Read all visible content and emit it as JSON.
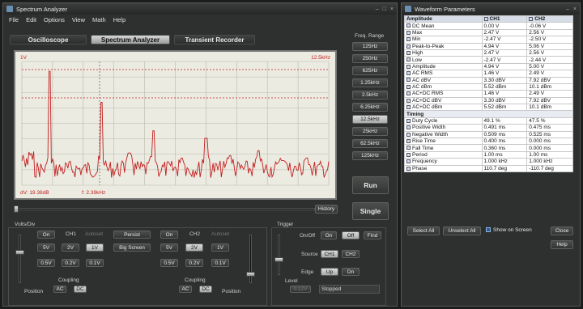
{
  "spectrum": {
    "title": "Spectrum Analyzer",
    "menu": [
      "File",
      "Edit",
      "Options",
      "View",
      "Math",
      "Help"
    ],
    "modes": [
      "Oscilloscope",
      "Spectrum Analyzer",
      "Transient Recorder"
    ],
    "active_mode": "Spectrum Analyzer",
    "freq_range_label": "Freq. Range",
    "freq_ranges": [
      "125Hz",
      "250Hz",
      "625Hz",
      "1.25kHz",
      "2.5kHz",
      "6.25kHz",
      "12.5kHz",
      "25kHz",
      "62.5kHz",
      "125kHz"
    ],
    "selected_freq_range": "12.5kHz",
    "plot": {
      "top_left": "1V",
      "top_right": "12.5kHz",
      "bottom_dv": "dV: 19.38dB",
      "bottom_f": "f: 2.39kHz",
      "trace_color": "#c41e1e"
    },
    "history_label": "History",
    "run_label": "Run",
    "single_label": "Single",
    "volts_div_label": "Volts/Div",
    "ch1": {
      "label": "CH1",
      "on": "On",
      "autoset": "Autoset",
      "volts": [
        "5V",
        "2V",
        "1V",
        "0.5V",
        "0.2V",
        "0.1V"
      ],
      "selected": "1V",
      "coupling_label": "Coupling",
      "coupling": [
        "AC",
        "DC"
      ],
      "selected_coupling": "DC"
    },
    "ch2": {
      "label": "CH2",
      "on": "On",
      "autoset": "Autoset",
      "volts": [
        "5V",
        "2V",
        "1V",
        "0.5V",
        "0.2V",
        "0.1V"
      ],
      "selected": "2V",
      "coupling_label": "Coupling",
      "coupling": [
        "AC",
        "DC"
      ],
      "selected_coupling": "DC"
    },
    "persist_label": "Persist",
    "big_screen_label": "Big Screen",
    "position_label": "Position",
    "trigger": {
      "label": "Trigger",
      "onoff_label": "On/Off",
      "on": "On",
      "off": "Off",
      "find": "Find",
      "source_label": "Source",
      "sources": [
        "CH1",
        "CH2"
      ],
      "selected_source": "CH1",
      "edge_label": "Edge",
      "edges": [
        "Up",
        "Dn"
      ],
      "selected_edge": "Up",
      "level_label": "Level",
      "level_value": "0.12V",
      "status": "Stopped"
    }
  },
  "waveform": {
    "title": "Waveform Parameters",
    "columns": [
      "Amplitude",
      "CH1",
      "CH2"
    ],
    "rows": [
      {
        "name": "DC Mean",
        "ch1": "0.00 V",
        "ch2": "-0.06 V"
      },
      {
        "name": "Max",
        "ch1": "2.47 V",
        "ch2": "2.56 V"
      },
      {
        "name": "Min",
        "ch1": "-2.47 V",
        "ch2": "-2.50 V"
      },
      {
        "name": "Peak-to-Peak",
        "ch1": "4.94 V",
        "ch2": "5.06 V"
      },
      {
        "name": "High",
        "ch1": "2.47 V",
        "ch2": "2.56 V"
      },
      {
        "name": "Low",
        "ch1": "-2.47 V",
        "ch2": "-2.44 V"
      },
      {
        "name": "Amplitude",
        "ch1": "4.94 V",
        "ch2": "5.00 V"
      },
      {
        "name": "AC RMS",
        "ch1": "1.46 V",
        "ch2": "2.49 V"
      },
      {
        "name": "AC dBV",
        "ch1": "3.30 dBV",
        "ch2": "7.92 dBV"
      },
      {
        "name": "AC dBm",
        "ch1": "5.52 dBm",
        "ch2": "10.1 dBm"
      },
      {
        "name": "AC+DC RMS",
        "ch1": "1.46 V",
        "ch2": "2.49 V"
      },
      {
        "name": "AC+DC dBV",
        "ch1": "3.30 dBV",
        "ch2": "7.92 dBV"
      },
      {
        "name": "AC+DC dBm",
        "ch1": "5.52 dBm",
        "ch2": "10.1 dBm"
      }
    ],
    "timing_label": "Timing",
    "timing_rows": [
      {
        "name": "Duty Cycle",
        "ch1": "49.1 %",
        "ch2": "47.5 %"
      },
      {
        "name": "Positive Width",
        "ch1": "0.491 ms",
        "ch2": "0.475 ms"
      },
      {
        "name": "Negative Width",
        "ch1": "0.509 ms",
        "ch2": "0.525 ms"
      },
      {
        "name": "Rise Time",
        "ch1": "0.400 ms",
        "ch2": "0.000 ms"
      },
      {
        "name": "Fall Time",
        "ch1": "0.360 ms",
        "ch2": "0.000 ms"
      },
      {
        "name": "Period",
        "ch1": "1.00 ms",
        "ch2": "1.00 ms"
      },
      {
        "name": "Frequency",
        "ch1": "1.000 kHz",
        "ch2": "1.000 kHz"
      },
      {
        "name": "Phase",
        "ch1": "110.7 deg",
        "ch2": "-110.7 deg"
      }
    ],
    "select_all": "Select All",
    "unselect_all": "Unselect All",
    "show_on_screen": "Show on Screen",
    "close": "Close",
    "help": "Help"
  }
}
